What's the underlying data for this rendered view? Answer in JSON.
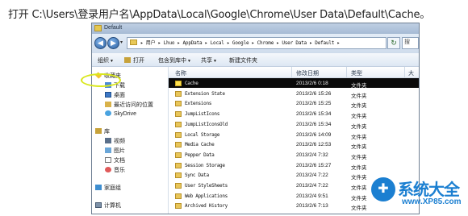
{
  "caption": "打开 C:\\Users\\登录用户名\\AppData\\Local\\Google\\Chrome\\User Data\\Default\\Cache。",
  "window": {
    "title": "Default",
    "address": {
      "crumbs": [
        "用户",
        "Lhuo",
        "AppData",
        "Local",
        "Google",
        "Chrome",
        "User Data",
        "Default"
      ],
      "separator": " ▸ ",
      "lead_arrow": "▸",
      "trail_arrow": "▸"
    },
    "nav": {
      "back_glyph": "◀",
      "forward_glyph": "▶",
      "dropdown_glyph": "▾",
      "refresh_glyph": "↻",
      "search_glyph": "搜"
    },
    "toolbar": {
      "organize": "组织",
      "open": "打开",
      "include": "包含到库中",
      "share": "共享",
      "new_folder": "新建文件夹",
      "arrow": "▼"
    },
    "sidebar": {
      "favorites": "收藏夹",
      "downloads": "下载",
      "desktop": "桌面",
      "recent": "最近访问的位置",
      "skydrive": "SkyDrive",
      "libraries": "库",
      "videos": "视频",
      "pictures": "图片",
      "documents": "文档",
      "music": "音乐",
      "homegroup": "家庭组",
      "computer": "计算机"
    },
    "columns": {
      "name": "名称",
      "date": "修改日期",
      "type": "类型",
      "size": "大"
    },
    "files": [
      {
        "name": "Cache",
        "date": "2013/2/6 0:18",
        "type": "文件夹",
        "selected": true
      },
      {
        "name": "Extension State",
        "date": "2013/2/6 15:26",
        "type": "文件夹"
      },
      {
        "name": "Extensions",
        "date": "2013/2/6 15:25",
        "type": "文件夹"
      },
      {
        "name": "JumpListIcons",
        "date": "2013/2/6 15:34",
        "type": "文件夹"
      },
      {
        "name": "JumpListIconsOld",
        "date": "2013/2/6 15:34",
        "type": "文件夹"
      },
      {
        "name": "Local Storage",
        "date": "2013/2/6 14:09",
        "type": "文件夹"
      },
      {
        "name": "Media Cache",
        "date": "2013/2/6 12:53",
        "type": "文件夹"
      },
      {
        "name": "Pepper Data",
        "date": "2013/2/4 7:32",
        "type": "文件夹"
      },
      {
        "name": "Session Storage",
        "date": "2013/2/6 15:27",
        "type": "文件夹"
      },
      {
        "name": "Sync Data",
        "date": "2013/2/4 7:22",
        "type": "文件夹"
      },
      {
        "name": "User StyleSheets",
        "date": "2013/2/4 7:22",
        "type": "文件夹"
      },
      {
        "name": "Web Applications",
        "date": "2013/2/4 9:51",
        "type": "文件夹"
      },
      {
        "name": "Archived History",
        "date": "2013/2/6 7:13",
        "type": "文件夹"
      }
    ]
  },
  "watermark": {
    "name": "系统大全",
    "url": "www.XP85.com"
  },
  "colors": {
    "selected_row": "#0a0a0a",
    "highlight_ring": "#d9e71c",
    "watermark": "#1b7fd1"
  }
}
